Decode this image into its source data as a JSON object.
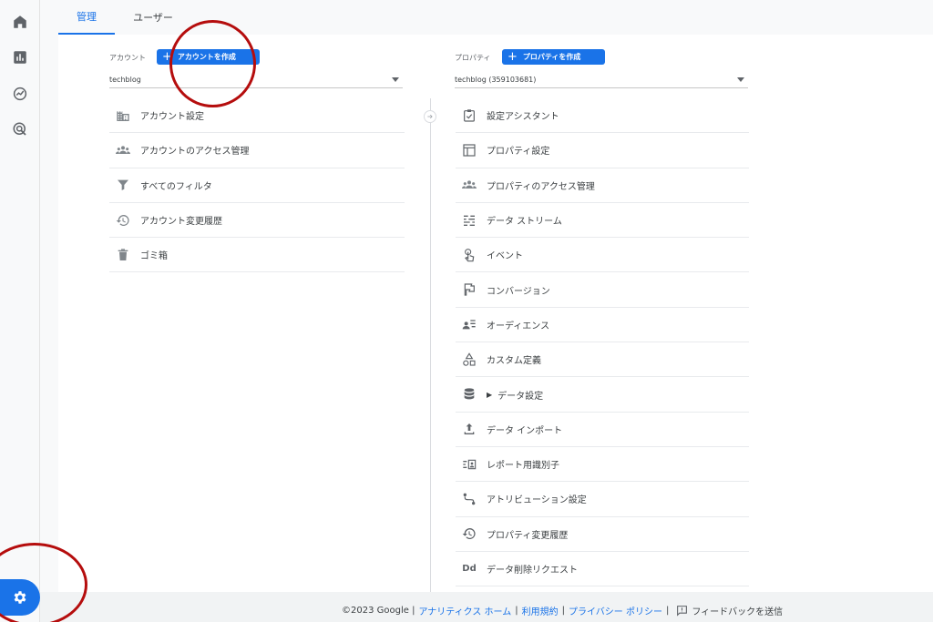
{
  "rail": {
    "icons": [
      "home-icon",
      "reports-icon",
      "explore-icon",
      "advertising-icon"
    ],
    "admin_icon": "gear-icon"
  },
  "tabs": [
    {
      "label": "管理",
      "active": true
    },
    {
      "label": "ユーザー",
      "active": false
    }
  ],
  "account": {
    "label": "アカウント",
    "create_button": "アカウントを作成",
    "selected": "techblog",
    "items": [
      {
        "label": "アカウント設定",
        "icon": "building-icon"
      },
      {
        "label": "アカウントのアクセス管理",
        "icon": "people-icon"
      },
      {
        "label": "すべてのフィルタ",
        "icon": "filter-icon"
      },
      {
        "label": "アカウント変更履歴",
        "icon": "history-icon"
      },
      {
        "label": "ゴミ箱",
        "icon": "trash-icon"
      }
    ]
  },
  "property": {
    "label": "プロパティ",
    "create_button": "プロパティを作成",
    "selected": "techblog (359103681)",
    "items": [
      {
        "label": "設定アシスタント",
        "icon": "checklist-icon"
      },
      {
        "label": "プロパティ設定",
        "icon": "layout-icon"
      },
      {
        "label": "プロパティのアクセス管理",
        "icon": "people-icon"
      },
      {
        "label": "データ ストリーム",
        "icon": "streams-icon"
      },
      {
        "label": "イベント",
        "icon": "touch-icon"
      },
      {
        "label": "コンバージョン",
        "icon": "flag-icon"
      },
      {
        "label": "オーディエンス",
        "icon": "audience-icon"
      },
      {
        "label": "カスタム定義",
        "icon": "shapes-icon"
      },
      {
        "label": "データ設定",
        "icon": "database-icon",
        "expandable": true
      },
      {
        "label": "データ インポート",
        "icon": "upload-icon"
      },
      {
        "label": "レポート用識別子",
        "icon": "identity-icon"
      },
      {
        "label": "アトリビューション設定",
        "icon": "attribution-icon"
      },
      {
        "label": "プロパティ変更履歴",
        "icon": "history-icon"
      },
      {
        "label": "データ削除リクエスト",
        "icon": "dd-icon"
      }
    ]
  },
  "footer": {
    "copyright": "©2023 Google |",
    "links": [
      "アナリティクス ホーム",
      "利用規約",
      "プライバシー ポリシー"
    ],
    "feedback": "フィードバックを送信"
  },
  "colors": {
    "accent": "#1a73e8",
    "annotation": "#b50d0d"
  }
}
